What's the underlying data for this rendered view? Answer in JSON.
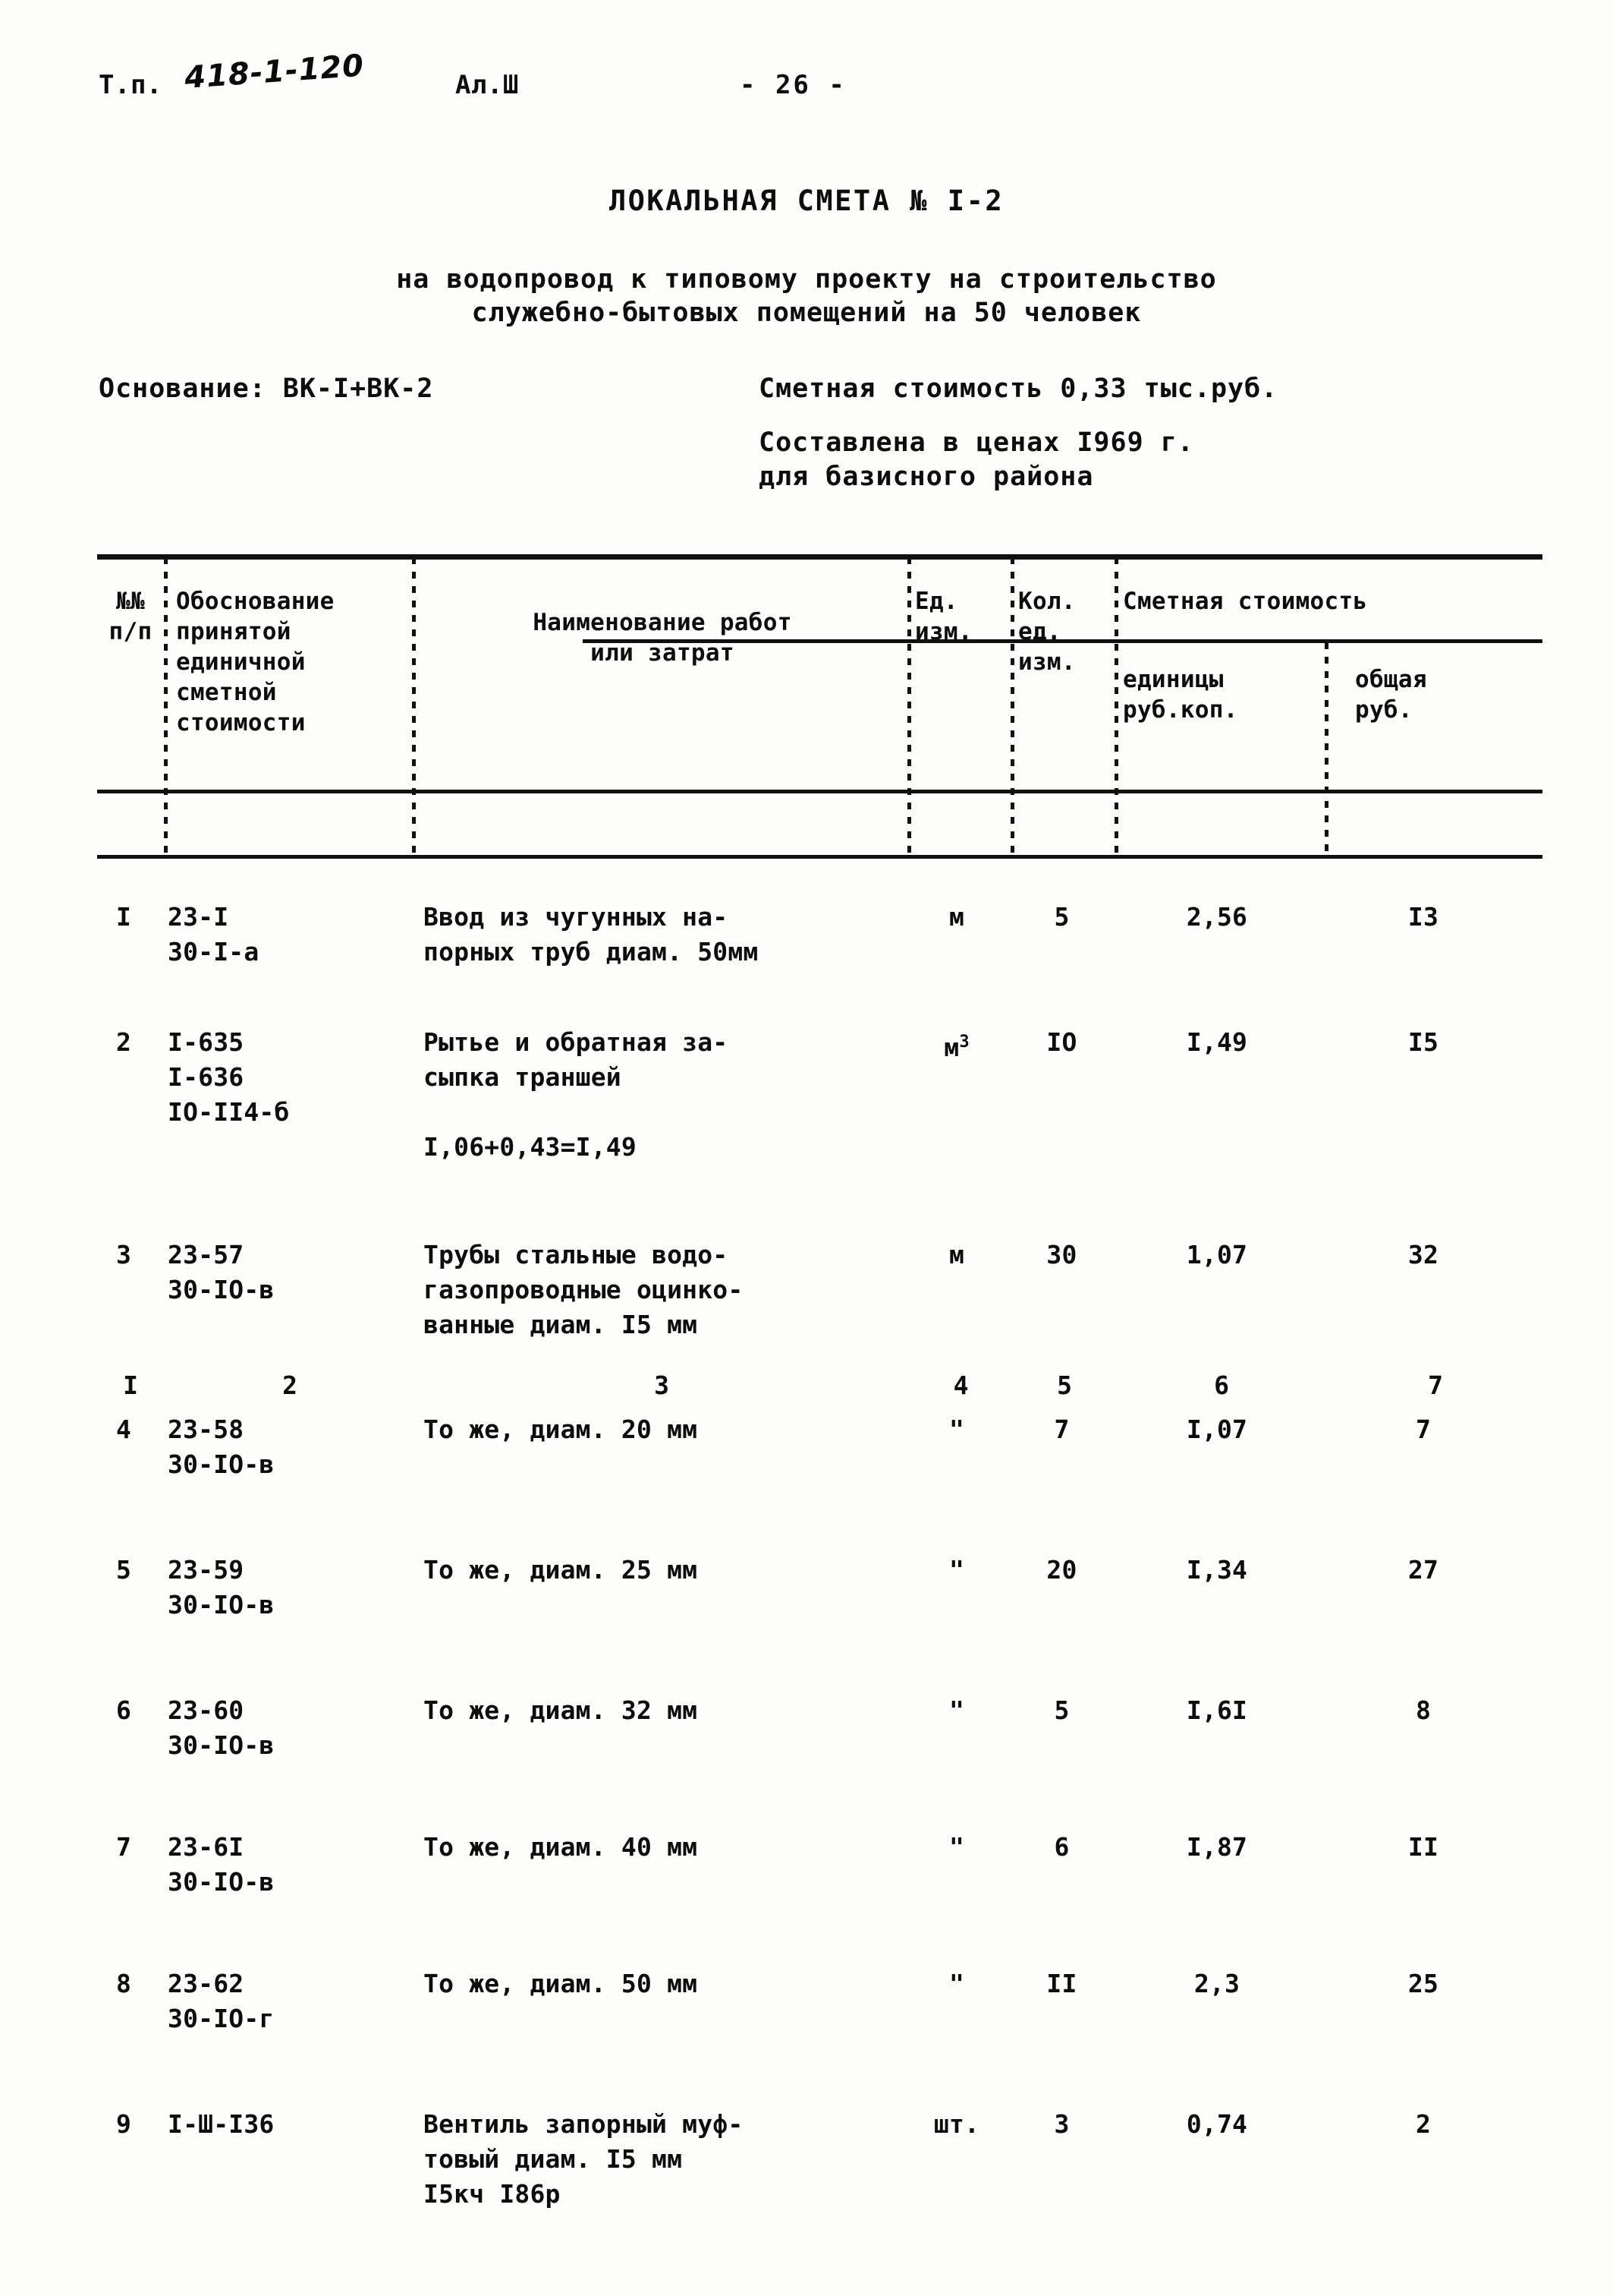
{
  "header": {
    "doc_code_label": "Т.п.",
    "doc_code_value": "418-1-120",
    "album_label": "Ал.Ш",
    "page_number": "- 26 -"
  },
  "titles": {
    "smeta_title": "ЛОКАЛЬНАЯ СМЕТА № I-2",
    "subtitle_line_1": "на водопровод к типовому проекту на строительство",
    "subtitle_line_2": "служебно-бытовых помещений на 50 человек"
  },
  "basis_block": {
    "basis_line": "Основание: ВК-I+ВК-2",
    "cost_line": "Сметная стоимость 0,33 тыс.руб.",
    "prices_line": "Составлена в ценах I969 г.",
    "region_line": "для базисного района"
  },
  "table": {
    "headers": {
      "col1": "№№\nп/п",
      "col2": "Обоснование\nпринятой\nединичной\nсметной\nстоимости",
      "col3": "Наименование работ\nили затрат",
      "col4": "Ед.\nизм.",
      "col5": "Кол.\nед.\nизм.",
      "col_group_cost": "Сметная стоимость",
      "col6": "единицы\nруб.коп.",
      "col7": "общая\nруб."
    },
    "column_numbers": [
      "I",
      "2",
      "3",
      "4",
      "5",
      "6",
      "7"
    ],
    "rows": [
      {
        "no": "I",
        "justification": "23-I\n30-I-а",
        "name": "Ввод из чугунных на-\nпорных труб диам. 50мм",
        "unit": "м",
        "unit_sup": "",
        "qty": "5",
        "unit_price": "2,56",
        "total": "I3"
      },
      {
        "no": "2",
        "justification": "I-635\nI-636\nIO-II4-б",
        "name": "Рытье и обратная за-\nсыпка траншей\n\nI,06+0,43=I,49",
        "unit": "м",
        "unit_sup": "3",
        "qty": "IO",
        "unit_price": "I,49",
        "total": "I5"
      },
      {
        "no": "3",
        "justification": "23-57\n30-IO-в",
        "name": "Трубы стальные водо-\n  газопроводные оцинко-\nванные диам. I5 мм",
        "unit": "м",
        "unit_sup": "",
        "qty": "30",
        "unit_price": "1,07",
        "total": "32"
      },
      {
        "no": "4",
        "justification": "23-58\n30-IO-в",
        "name": "То же, диам. 20 мм",
        "unit": "\"",
        "unit_sup": "",
        "qty": "7",
        "unit_price": "I,07",
        "total": "7"
      },
      {
        "no": "5",
        "justification": "23-59\n30-IO-в",
        "name": "То же, диам. 25 мм",
        "unit": "\"",
        "unit_sup": "",
        "qty": "20",
        "unit_price": "I,34",
        "total": "27"
      },
      {
        "no": "6",
        "justification": "23-60\n30-IO-в",
        "name": "То же, диам. 32 мм",
        "unit": "\"",
        "unit_sup": "",
        "qty": "5",
        "unit_price": "I,6I",
        "total": "8"
      },
      {
        "no": "7",
        "justification": "23-6I\n30-IO-в",
        "name": "То же, диам. 40 мм",
        "unit": "\"",
        "unit_sup": "",
        "qty": "6",
        "unit_price": "I,87",
        "total": "II"
      },
      {
        "no": "8",
        "justification": "23-62\n30-IO-г",
        "name": "То же, диам. 50 мм",
        "unit": "\"",
        "unit_sup": "",
        "qty": "II",
        "unit_price": "2,3",
        "total": "25"
      },
      {
        "no": "9",
        "justification": "I-Ш-I36",
        "name": "Вентиль запорный муф-\nтовый диам. I5 мм\nI5кч I86р",
        "unit": "шт.",
        "unit_sup": "",
        "qty": "3",
        "unit_price": "0,74",
        "total": "2"
      }
    ]
  },
  "colors": {
    "ink": "#0d0d0d",
    "paper": "#fdfdfc"
  }
}
